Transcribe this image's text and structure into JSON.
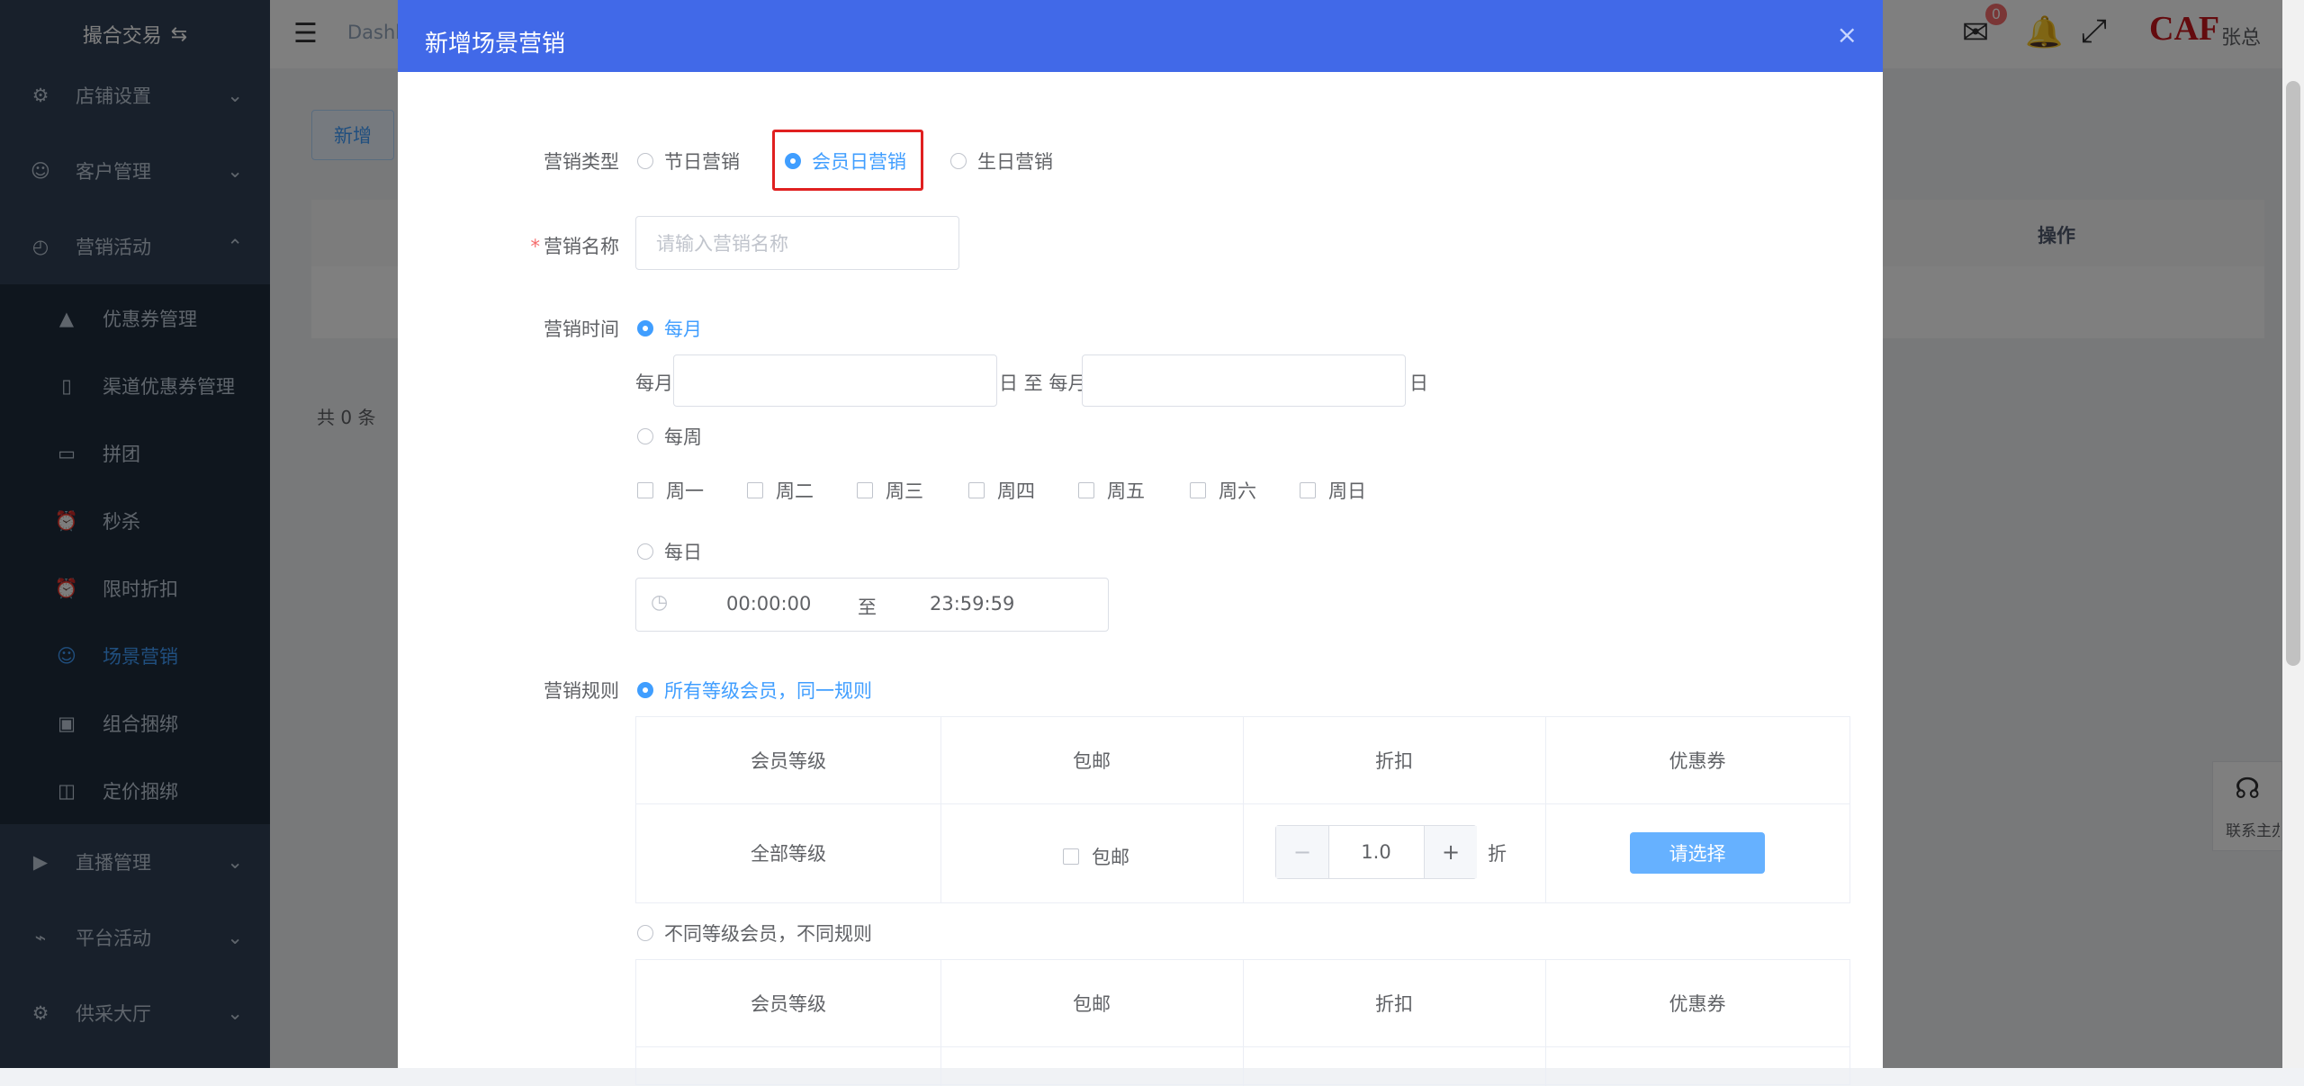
{
  "sidebar": {
    "brand": "撮合交易",
    "menu": [
      {
        "label": "店铺设置",
        "icon": "gear-icon"
      },
      {
        "label": "客户管理",
        "icon": "user-icon"
      },
      {
        "label": "营销活动",
        "icon": "compass-icon"
      },
      {
        "label": "直播管理",
        "icon": "video-icon"
      },
      {
        "label": "平台活动",
        "icon": "chart-icon"
      },
      {
        "label": "供采大厅",
        "icon": "gear-icon"
      }
    ],
    "submenu": [
      {
        "label": "优惠券管理",
        "icon": "lock-icon"
      },
      {
        "label": "渠道优惠券管理",
        "icon": "phone-icon"
      },
      {
        "label": "拼团",
        "icon": "briefcase-icon"
      },
      {
        "label": "秒杀",
        "icon": "alarm-icon"
      },
      {
        "label": "限时折扣",
        "icon": "alarm-icon"
      },
      {
        "label": "场景营销",
        "icon": "smile-icon"
      },
      {
        "label": "组合捆绑",
        "icon": "box-icon"
      },
      {
        "label": "定价捆绑",
        "icon": "bag-icon"
      }
    ]
  },
  "header": {
    "breadcrumb": "Dashb",
    "mail_count": "0",
    "logo_text": "CAF",
    "user": "张总"
  },
  "background_page": {
    "add_button": "新增",
    "table_action_header": "操作",
    "total": "共 0 条",
    "contact": "联系主办"
  },
  "dialog": {
    "title": "新增场景营销",
    "close": "×",
    "type_label": "营销类型",
    "type_options": [
      "节日营销",
      "会员日营销",
      "生日营销"
    ],
    "type_selected": "会员日营销",
    "name_label": "营销名称",
    "name_placeholder": "请输入营销名称",
    "time_label": "营销时间",
    "monthly": "每月",
    "month_prefix": "每月",
    "month_mid": "日 至 每月",
    "month_suffix": "日",
    "weekly": "每周",
    "weekdays": [
      "周一",
      "周二",
      "周三",
      "周四",
      "周五",
      "周六",
      "周日"
    ],
    "daily": "每日",
    "time_start": "00:00:00",
    "time_sep": "至",
    "time_end": "23:59:59",
    "rule_label": "营销规则",
    "rule_same": "所有等级会员，同一规则",
    "rule_diff": "不同等级会员，不同规则",
    "table_headers": [
      "会员等级",
      "包邮",
      "折扣",
      "优惠券"
    ],
    "row_level": "全部等级",
    "row_free_shipping": "包邮",
    "discount_value": "1.0",
    "discount_unit": "折",
    "stepper_minus": "−",
    "stepper_plus": "+",
    "coupon_button": "请选择"
  },
  "colors": {
    "dialog_header": "#4169e8",
    "accent": "#409eff",
    "highlight": "#e02020",
    "sidebar": "#304156"
  }
}
